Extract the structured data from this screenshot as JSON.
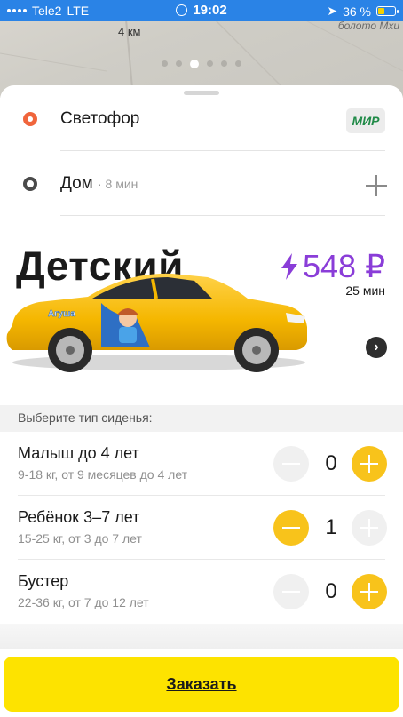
{
  "status_bar": {
    "carrier": "Tele2",
    "network": "LTE",
    "time": "19:02",
    "battery": "36 %",
    "battery_level": 0.36
  },
  "map": {
    "distance": "4 км",
    "place_name": "болото Мхи",
    "page_indicator": {
      "count": 6,
      "active_index": 2
    }
  },
  "route": {
    "from": {
      "label": "Светофор",
      "payment": "МИР"
    },
    "to": {
      "label": "Дом",
      "eta": "· 8 мин"
    }
  },
  "tariff": {
    "name": "Детский",
    "price": "548 ₽",
    "duration": "25 мин",
    "car_brand_sticker": "Агуша",
    "colors": {
      "price": "#8a3dd8",
      "car": "#f5b700"
    }
  },
  "seats": {
    "header": "Выберите тип сиденья:",
    "items": [
      {
        "name": "Малыш до 4 лет",
        "desc": "9-18 кг, от 9 месяцев до 4 лет",
        "count": "0"
      },
      {
        "name": "Ребёнок 3–7 лет",
        "desc": "15-25 кг, от 3 до 7 лет",
        "count": "1"
      },
      {
        "name": "Бустер",
        "desc": "22-36 кг, от 7 до 12 лет",
        "count": "0"
      }
    ]
  },
  "order_button": {
    "label": "Заказать",
    "color": "#fde300"
  },
  "accent_color": "#f8c31b"
}
